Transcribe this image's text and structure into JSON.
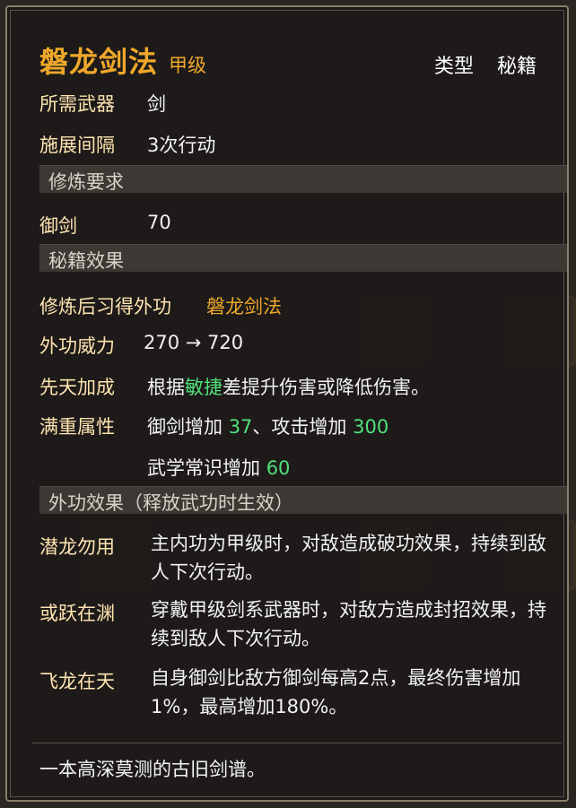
{
  "skill": {
    "name": "磐龙剑法",
    "grade": "甲级",
    "type_label": "类型",
    "type_value": "秘籍"
  },
  "basic": [
    {
      "label": "所需武器",
      "value": "剑"
    },
    {
      "label": "施展间隔",
      "value": "3次行动"
    }
  ],
  "requirements": {
    "header": "修炼要求",
    "items": [
      {
        "label": "御剑",
        "value": "70"
      }
    ]
  },
  "effects": {
    "header": "秘籍效果",
    "learn_label": "修炼后习得外功",
    "learn_value": "磐龙剑法",
    "power_label": "外功威力",
    "power_value": "270 → 720",
    "innate_label": "先天加成",
    "innate_pre": "根据",
    "innate_attr": "敏捷",
    "innate_post": "差提升伤害或降低伤害。",
    "maxlevel_label": "满重属性",
    "maxlevel_line1_a": "御剑增加 ",
    "maxlevel_line1_b": "37",
    "maxlevel_line1_c": "、攻击增加 ",
    "maxlevel_line1_d": "300",
    "maxlevel_line2_a": "武学常识增加 ",
    "maxlevel_line2_b": "60"
  },
  "external": {
    "header": "外功效果（释放武功时生效）",
    "items": [
      {
        "label": "潜龙勿用",
        "text": "主内功为甲级时，对敌造成破功效果，持续到敌人下次行动。"
      },
      {
        "label": "或跃在渊",
        "text": "穿戴甲级剑系武器时，对敌方造成封招效果，持续到敌人下次行动。"
      },
      {
        "label": "飞龙在天",
        "text": "自身御剑比敌方御剑每高2点，最终伤害增加1%，最高增加180%。"
      }
    ]
  },
  "footer": "一本高深莫测的古旧剑谱。",
  "colors": {
    "title": "#f0a82a",
    "label": "#ffe4b0",
    "green": "#50e07a"
  }
}
